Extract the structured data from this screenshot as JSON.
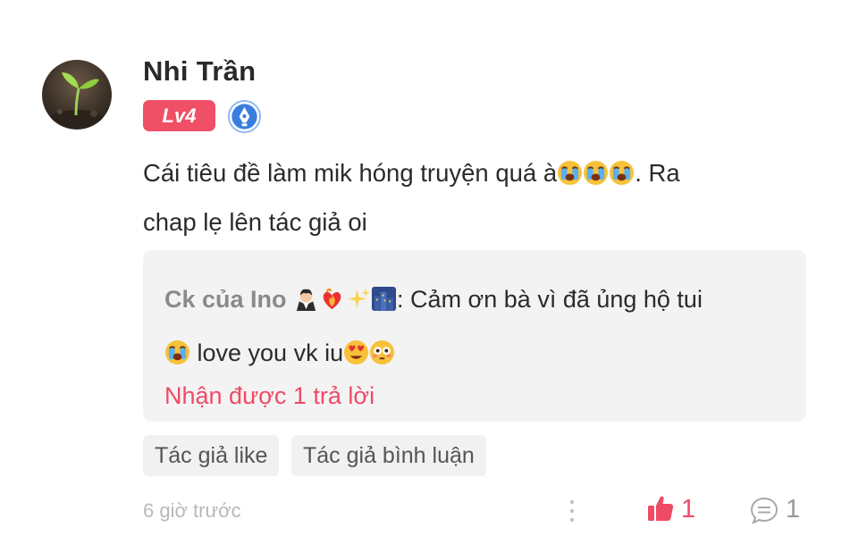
{
  "user": {
    "name": "Nhi Trần",
    "level": "Lv4",
    "avatar_icon": "sprout-avatar",
    "verified_icon": "pen-badge-icon"
  },
  "comment": {
    "text_line1": "Cái tiêu đề làm mik hóng truyện quá à",
    "text_suffix": ". Ra",
    "text_line2": "chap lẹ lên tác giả oi",
    "emoji": [
      "loudly-crying-face",
      "loudly-crying-face",
      "loudly-crying-face"
    ]
  },
  "reply": {
    "author": "Ck của Ino",
    "author_emoji": [
      "vampire",
      "heart-on-fire",
      "sparkles",
      "night-city"
    ],
    "text_part1": ": Cảm ơn bà vì đã ủng hộ tui",
    "text_part2": " love you vk iu",
    "reply_count_label": "Nhận được 1 trả lời"
  },
  "tags": [
    "Tác giả like",
    "Tác giả bình luận"
  ],
  "footer": {
    "timestamp": "6 giờ trước",
    "like_count": "1",
    "comment_count": "1"
  },
  "colors": {
    "accent": "#ef4a66",
    "level_badge": "#ef5066",
    "verified": "#3a7de0",
    "reply_bg": "#f3f3f3"
  }
}
